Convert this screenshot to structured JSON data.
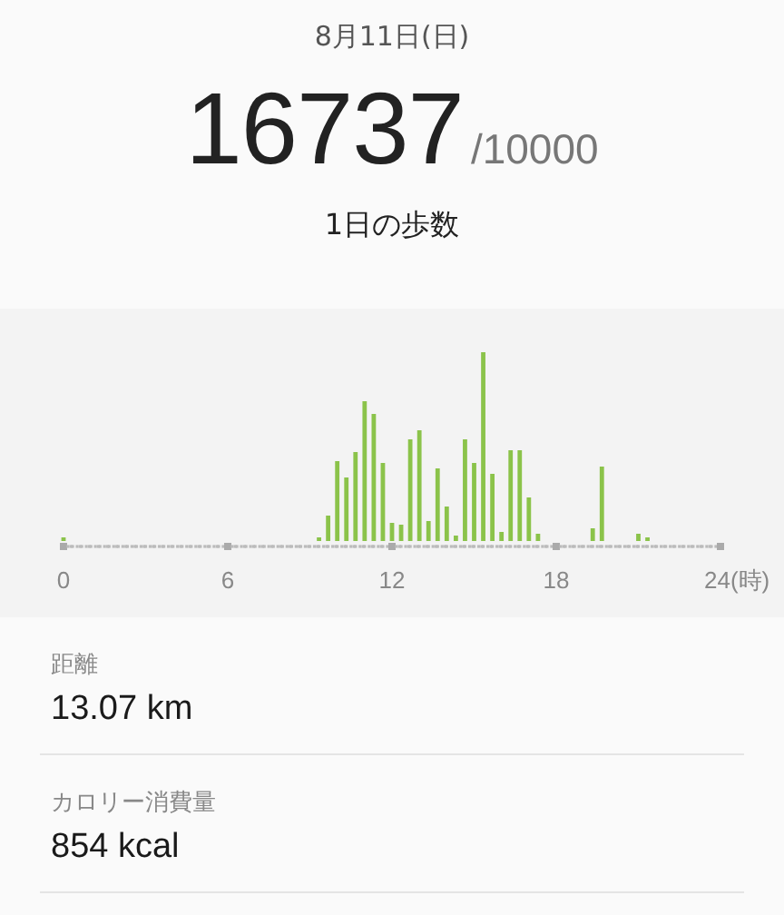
{
  "date": "8月11日(日)",
  "steps": {
    "value": "16737",
    "goal": "/10000",
    "label": "1日の歩数"
  },
  "hourly_chart": {
    "x_labels": [
      "0",
      "6",
      "12",
      "18",
      "24(時)"
    ]
  },
  "stats": [
    {
      "label": "距離",
      "value": "13.07 km"
    },
    {
      "label": "カロリー消費量",
      "value": "854 kcal"
    }
  ]
}
